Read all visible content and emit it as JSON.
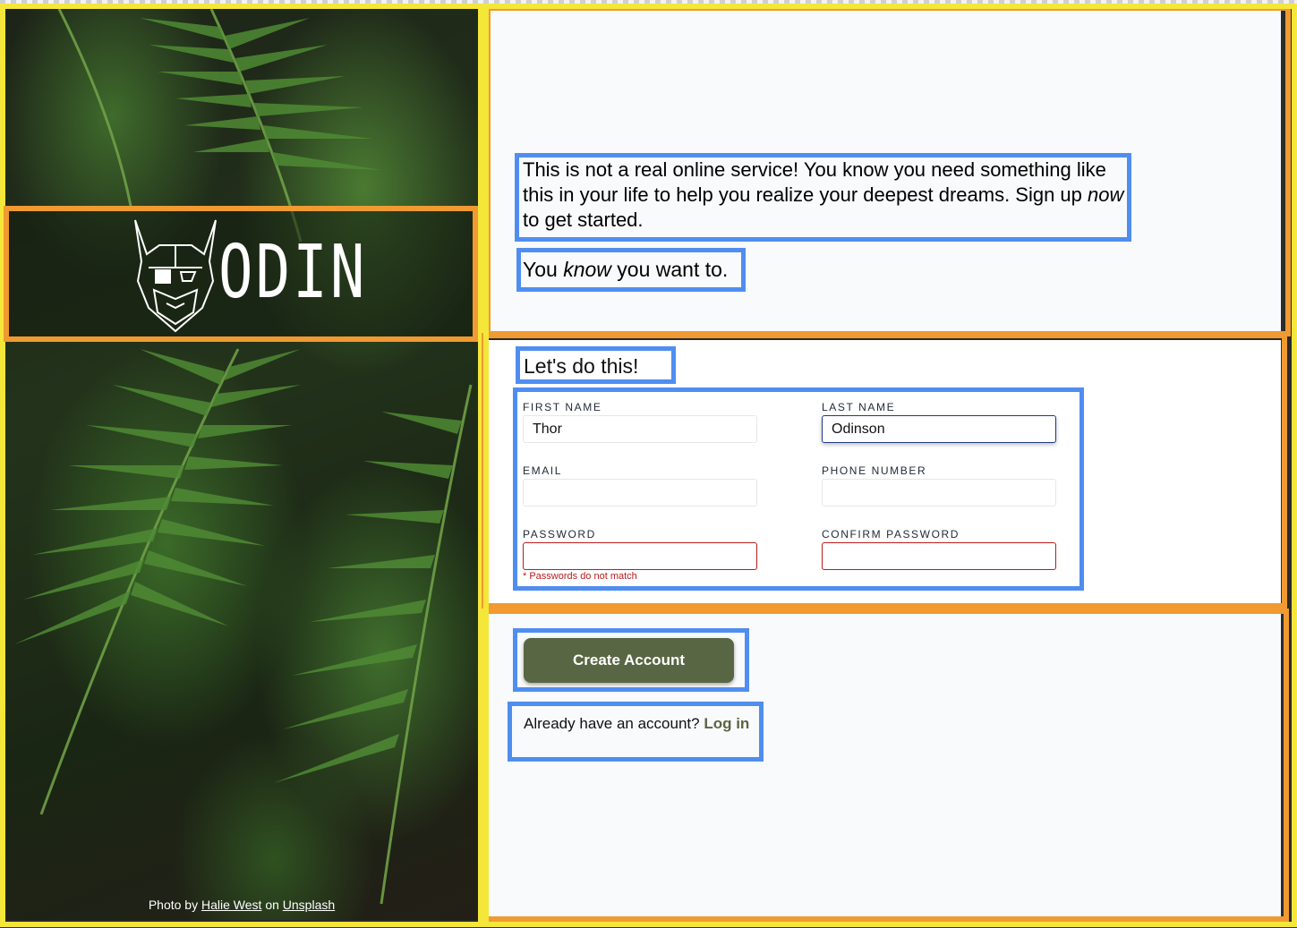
{
  "hero": {
    "logo_text": "ODIN",
    "credit_prefix": "Photo by",
    "credit_author": "Halie West",
    "credit_mid": "on",
    "credit_source": "Unsplash"
  },
  "intro": {
    "line_part1": "This is not a real online service! You know you need something like this in your life to help you realize your deepest dreams. Sign up",
    "emph_now": "now",
    "line_part2": "to get started.",
    "know_part1": "You",
    "know_emph": "know",
    "know_part2": "you want to."
  },
  "form": {
    "heading": "Let's do this!",
    "first_name": {
      "label": "FIRST NAME",
      "value": "Thor"
    },
    "last_name": {
      "label": "LAST NAME",
      "value": "Odinson"
    },
    "email": {
      "label": "EMAIL",
      "value": ""
    },
    "phone": {
      "label": "PHONE NUMBER",
      "value": ""
    },
    "password": {
      "label": "PASSWORD",
      "value": ""
    },
    "confirm_password": {
      "label": "CONFIRM PASSWORD",
      "value": ""
    },
    "error": "* Passwords do not match"
  },
  "actions": {
    "create_label": "Create Account",
    "already_text": "Already have an account?",
    "login_label": "Log in"
  },
  "colors": {
    "accent": "#596643",
    "error": "#b91c1c",
    "annotation_yellow": "#f5e63a",
    "annotation_orange": "#f09a31",
    "annotation_blue": "#4f8ef0"
  }
}
